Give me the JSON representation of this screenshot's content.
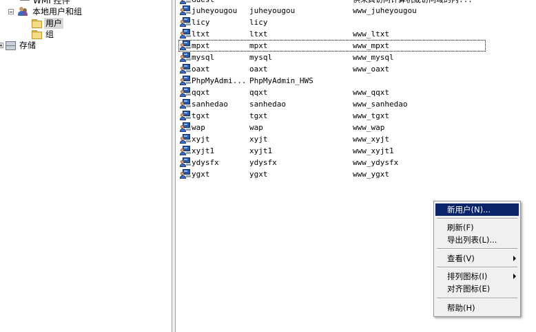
{
  "tree": {
    "items": [
      {
        "label": "WMI 控件"
      },
      {
        "label": "本地用户和组"
      },
      {
        "label": "用户"
      },
      {
        "label": "组"
      },
      {
        "label": "存储"
      }
    ]
  },
  "users": {
    "top_partial": {
      "name": "Guest",
      "desc": "供来宾访问计算机或访问域的内..."
    },
    "rows": [
      {
        "name": "juheyougou",
        "full": "juheyougou",
        "desc": "www_juheyougou"
      },
      {
        "name": "licy",
        "full": "licy",
        "desc": ""
      },
      {
        "name": "ltxt",
        "full": "ltxt",
        "desc": "www_ltxt"
      },
      {
        "name": "mpxt",
        "full": "mpxt",
        "desc": "www_mpxt"
      },
      {
        "name": "mysql",
        "full": "mysql",
        "desc": "www_mysql"
      },
      {
        "name": "oaxt",
        "full": "oaxt",
        "desc": "www_oaxt"
      },
      {
        "name": "PhpMyAdmi...",
        "full": "PhpMyAdmin_HWS",
        "desc": ""
      },
      {
        "name": "qqxt",
        "full": "qqxt",
        "desc": "www_qqxt"
      },
      {
        "name": "sanhedao",
        "full": "sanhedao",
        "desc": "www_sanhedao"
      },
      {
        "name": "tgxt",
        "full": "tgxt",
        "desc": "www_tgxt"
      },
      {
        "name": "wap",
        "full": "wap",
        "desc": "www_wap"
      },
      {
        "name": "xyjt",
        "full": "xyjt",
        "desc": "www_xyjt"
      },
      {
        "name": "xyjt1",
        "full": "xyjt1",
        "desc": "www_xyjt1"
      },
      {
        "name": "ydysfx",
        "full": "ydysfx",
        "desc": "www_ydysfx"
      },
      {
        "name": "ygxt",
        "full": "ygxt",
        "desc": "www_ygxt"
      }
    ]
  },
  "context_menu": {
    "new_user": "新用户(N)...",
    "refresh": "刷新(F)",
    "export_list": "导出列表(L)...",
    "view": "查看(V)",
    "arrange_icons": "排列图标(I)",
    "line_up_icons": "对齐图标(E)",
    "help": "帮助(H)"
  },
  "colors": {
    "menu_highlight": "#0a246a",
    "selection_bg": "#d9d9d9"
  }
}
